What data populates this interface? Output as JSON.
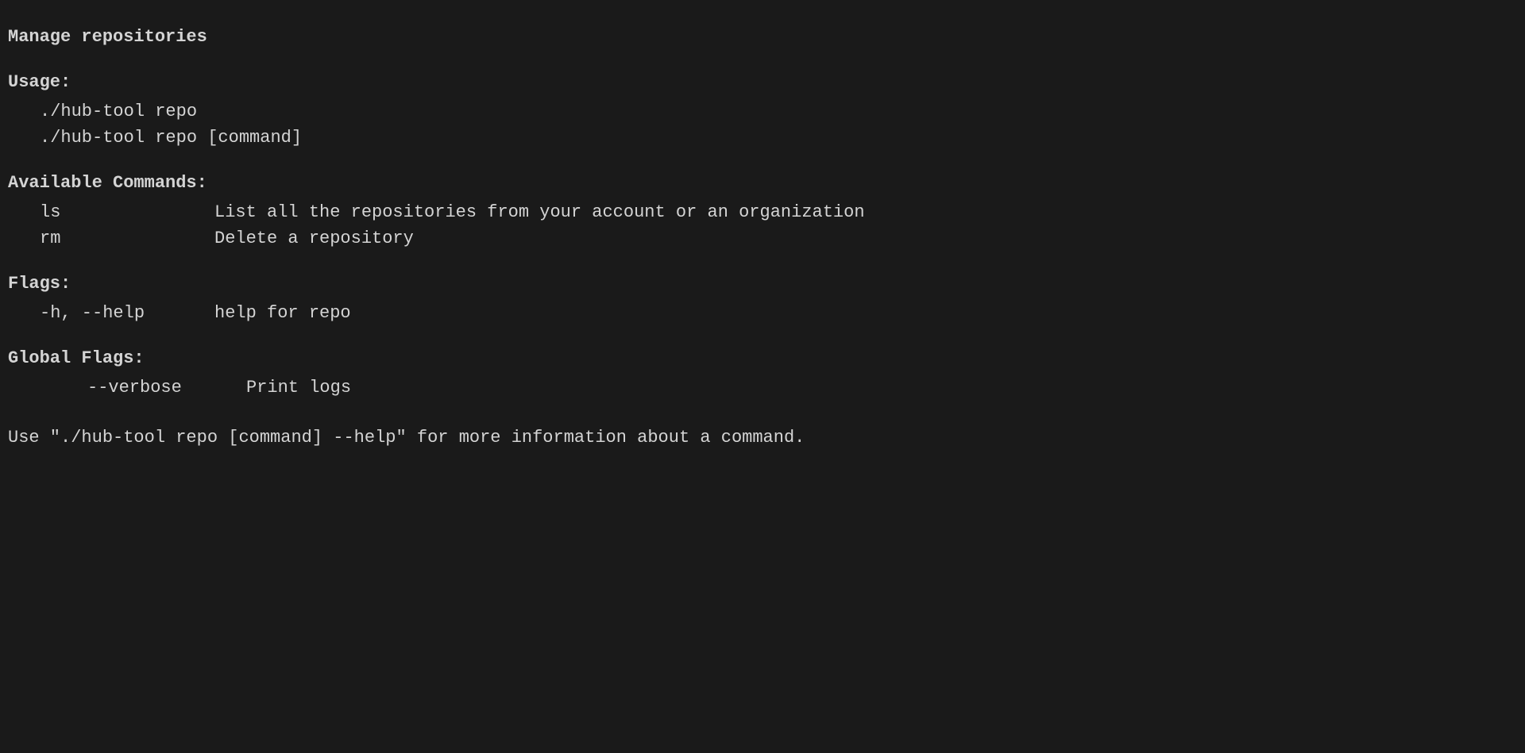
{
  "terminal": {
    "title": "Manage repositories",
    "usage_label": "Usage:",
    "usage_lines": [
      "  ./hub-tool repo",
      "  ./hub-tool repo [command]"
    ],
    "available_commands_label": "Available Commands:",
    "commands": [
      {
        "name": "ls",
        "description": "List all the repositories from your account or an organization"
      },
      {
        "name": "rm",
        "description": "Delete a repository"
      }
    ],
    "flags_label": "Flags:",
    "flags": [
      {
        "name": "-h, --help",
        "description": "help for repo"
      }
    ],
    "global_flags_label": "Global Flags:",
    "global_flags": [
      {
        "name": "--verbose",
        "description": "Print logs"
      }
    ],
    "footer": "Use \"./hub-tool repo [command] --help\" for more information about a command."
  }
}
